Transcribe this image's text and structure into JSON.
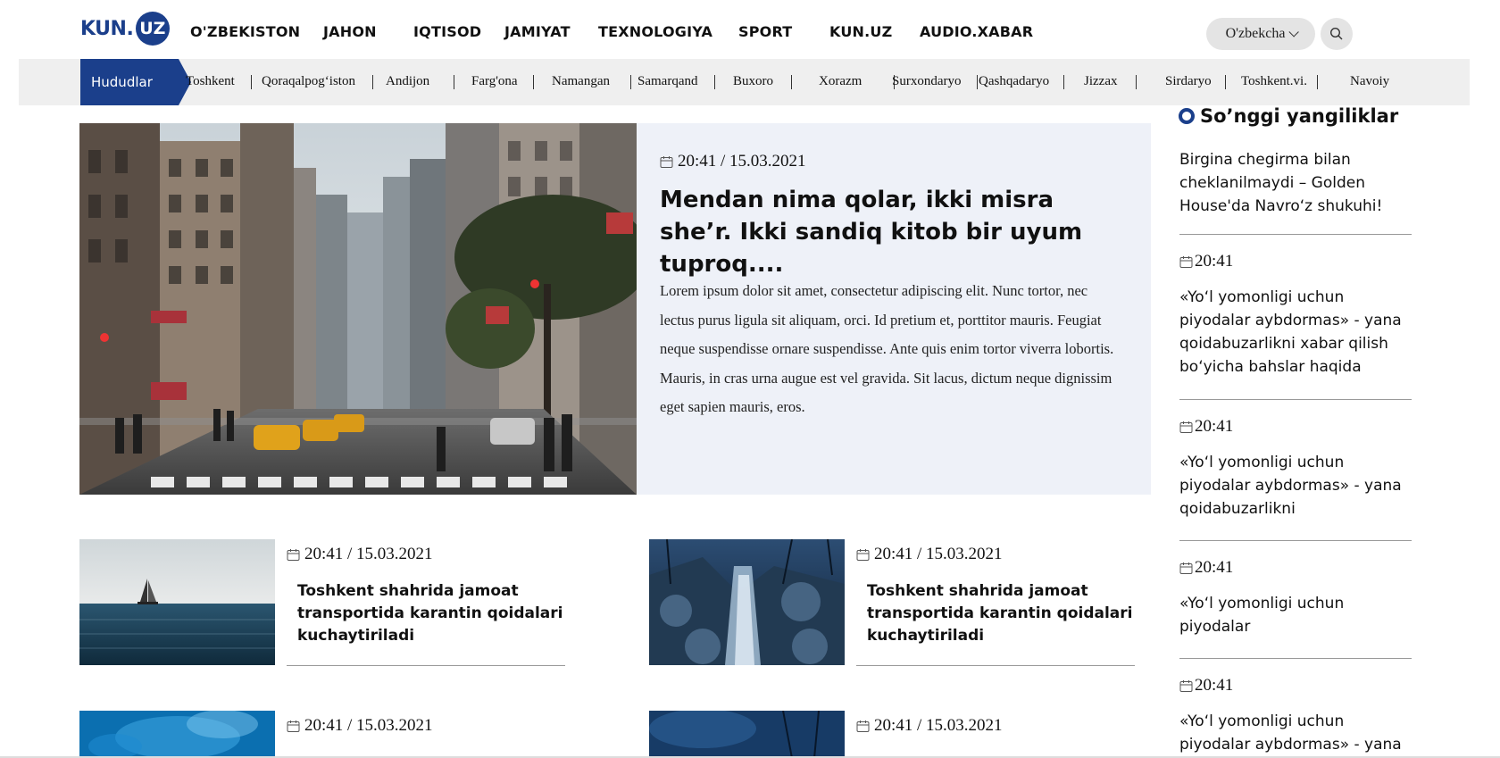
{
  "header": {
    "logo_text": "KUN",
    "logo_dot": ".",
    "logo_badge": "UZ",
    "nav": [
      "O'ZBEKISTON",
      "JAHON",
      "IQTISOD",
      "JAMIYAT",
      "TEXNOLOGIYA",
      "SPORT",
      "KUN.UZ",
      "AUDIO.XABAR"
    ],
    "language": "O'zbekcha"
  },
  "regions": {
    "label": "Hududlar",
    "items": [
      "Toshkent",
      "Qoraqalpog‘iston",
      "Andijon",
      "Farg'ona",
      "Namangan",
      "Samarqand",
      "Buxoro",
      "Xorazm",
      "Surxondaryo",
      "Qashqadaryo",
      "Jizzax",
      "Sirdaryo",
      "Toshkent.vi.",
      "Navoiy"
    ]
  },
  "hero": {
    "date": "20:41 / 15.03.2021",
    "title": "Mendan nima qolar, ikki misra she’r. Ikki sandiq kitob bir uyum tuproq....",
    "text": "Lorem ipsum dolor sit amet, consectetur adipiscing elit. Nunc tortor, nec lectus purus ligula sit aliquam, orci. Id pretium et, porttitor mauris. Feugiat neque suspendisse ornare suspendisse. Ante quis enim tortor viverra lobortis. Mauris, in cras urna augue est vel gravida. Sit lacus, dictum neque dignissim eget sapien mauris, eros."
  },
  "cards": [
    {
      "date": "20:41 / 15.03.2021",
      "title": "Toshkent shahrida jamoat transportida karantin qoidalari kuchaytiriladi"
    },
    {
      "date": "20:41 / 15.03.2021",
      "title": "Toshkent shahrida jamoat transportida karantin qoidalari kuchaytiriladi"
    },
    {
      "date": "20:41 / 15.03.2021",
      "title": ""
    },
    {
      "date": "20:41 / 15.03.2021",
      "title": ""
    }
  ],
  "sidebar": {
    "heading": "So’nggi yangiliklar",
    "first_title": "Birgina chegirma bilan cheklanilmaydi – Golden House'da Navro‘z shukuhi!",
    "items": [
      {
        "time": "20:41",
        "title": "«Yo‘l yomonligi uchun piyodalar aybdormas» - yana qoidabuzarlikni xabar qilish bo‘yicha bahslar haqida"
      },
      {
        "time": "20:41",
        "title": "«Yo‘l yomonligi uchun piyodalar aybdormas» - yana qoidabuzarlikni"
      },
      {
        "time": "20:41",
        "title": "«Yo‘l yomonligi uchun piyodalar"
      },
      {
        "time": "20:41",
        "title": "«Yo‘l yomonligi uchun piyodalar aybdormas» - yana"
      }
    ]
  },
  "icons": {
    "date": "calendar-icon",
    "search": "search-icon",
    "dropdown": "chevron-down-icon"
  },
  "colors": {
    "brand": "#1b3f8b",
    "regions_bar": "#efefef",
    "hero_panel": "#eef1f8"
  }
}
